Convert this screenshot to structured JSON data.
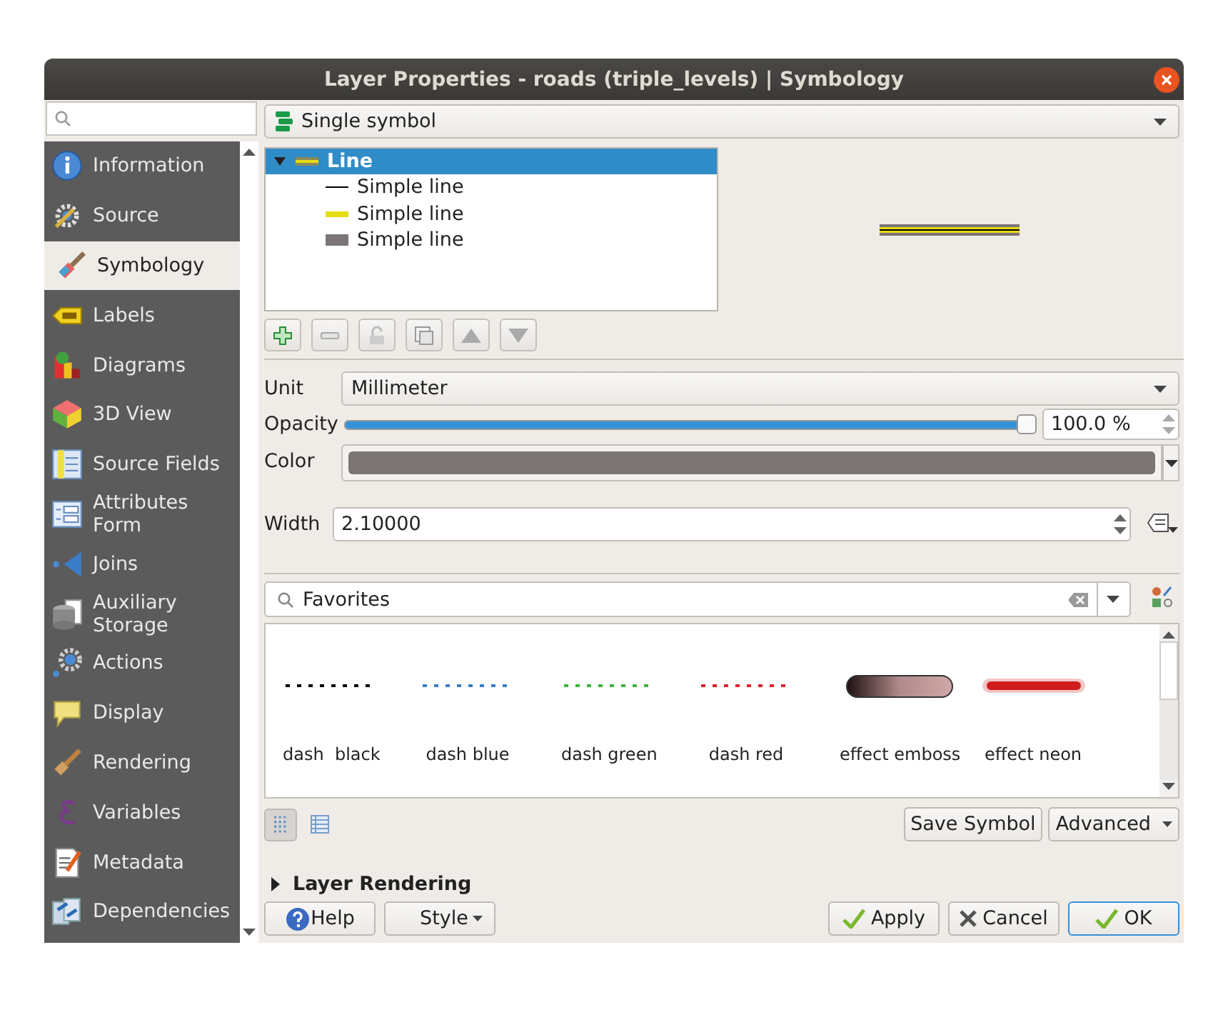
{
  "window": {
    "title": "Layer Properties - roads (triple_levels) | Symbology"
  },
  "sidebar": {
    "items": [
      {
        "label": "Information",
        "selected": false
      },
      {
        "label": "Source",
        "selected": false
      },
      {
        "label": "Symbology",
        "selected": true
      },
      {
        "label": "Labels",
        "selected": false
      },
      {
        "label": "Diagrams",
        "selected": false
      },
      {
        "label": "3D View",
        "selected": false
      },
      {
        "label": "Source Fields",
        "selected": false
      },
      {
        "label": "Attributes Form",
        "selected": false
      },
      {
        "label": "Joins",
        "selected": false
      },
      {
        "label": "Auxiliary Storage",
        "selected": false
      },
      {
        "label": "Actions",
        "selected": false
      },
      {
        "label": "Display",
        "selected": false
      },
      {
        "label": "Rendering",
        "selected": false
      },
      {
        "label": "Variables",
        "selected": false
      },
      {
        "label": "Metadata",
        "selected": false
      },
      {
        "label": "Dependencies",
        "selected": false
      }
    ]
  },
  "renderer": {
    "value": "Single symbol"
  },
  "symbol_tree": {
    "label": "Line",
    "expanded": true,
    "selected": true,
    "children": [
      {
        "label": "Simple line",
        "color": "#000000",
        "selected": false
      },
      {
        "label": "Simple line",
        "color": "#e6dc14",
        "selected": false
      },
      {
        "label": "Simple line",
        "color": "#7b7575",
        "selected": false
      }
    ]
  },
  "properties": {
    "unit": {
      "label": "Unit",
      "value": "Millimeter"
    },
    "opacity": {
      "label": "Opacity",
      "level": 1,
      "reading": "100.0 %"
    },
    "color": {
      "label": "Color",
      "color": "#7b7575"
    },
    "width": {
      "label": "Width",
      "value": "2.10000"
    }
  },
  "library": {
    "search": {
      "value": "Favorites"
    },
    "symbols": [
      {
        "name": "dash  black",
        "kind": "dashed",
        "color": "#000000"
      },
      {
        "name": "dash blue",
        "kind": "dashed",
        "color": "#3a7cc8"
      },
      {
        "name": "dash green",
        "kind": "dashed",
        "color": "#3cb43c"
      },
      {
        "name": "dash red",
        "kind": "dashed",
        "color": "#e0202c"
      },
      {
        "name": "effect emboss",
        "kind": "emboss",
        "color": "#b08a8a"
      },
      {
        "name": "effect neon",
        "kind": "neon",
        "color": "#d01c1c"
      }
    ],
    "views": [
      {
        "kind": "icons",
        "selected": true
      },
      {
        "kind": "list",
        "selected": false
      }
    ],
    "save_button": "Save Symbol",
    "advanced_button": "Advanced"
  },
  "layer_rendering": {
    "label": "Layer Rendering",
    "expanded": false
  },
  "buttons": {
    "help": "Help",
    "style": "Style",
    "apply": "Apply",
    "cancel": "Cancel",
    "ok": "OK"
  }
}
